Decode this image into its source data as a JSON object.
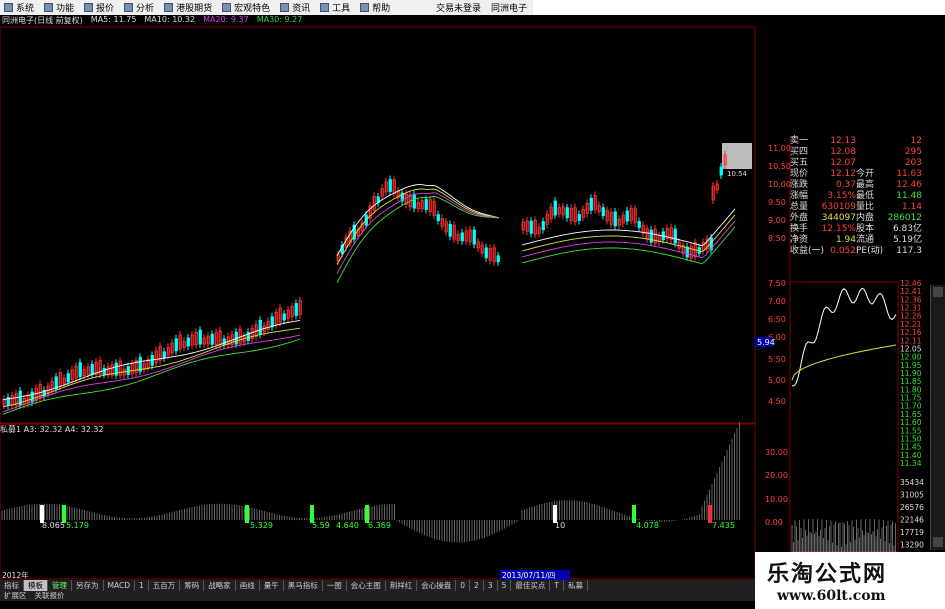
{
  "menubar": {
    "items": [
      "系统",
      "功能",
      "报价",
      "分析",
      "港股期货",
      "宏观特色",
      "资讯",
      "工具",
      "帮助"
    ],
    "right_items": [
      "交易未登录",
      "同洲电子"
    ]
  },
  "infobar": {
    "stock": "同洲电子(日线 前复权)",
    "ma5": "MA5: 11.75",
    "ma10": "MA10: 10.32",
    "ma20": "MA20: 9.37",
    "ma30": "MA30: 9.27"
  },
  "indicator": {
    "title_a": "私募1",
    "title_b": "A3: 32.32",
    "title_c": "A4: 32.32"
  },
  "price_axis": [
    "11.00",
    "10.50",
    "10.00",
    "9.50",
    "9.00",
    "8.50",
    "7.50",
    "7.00",
    "6.50",
    "6.00",
    "5.50",
    "5.00",
    "4.50"
  ],
  "indicator_axis": [
    "30.00",
    "20.00",
    "10.00",
    "0.00"
  ],
  "chart_labels": {
    "current_price": "5.94",
    "high_label": "10.54",
    "ind_values": [
      "8.065",
      "5.179",
      "5.329",
      "5.59",
      "4.640",
      "6.369",
      "10",
      "4.078",
      "7.435"
    ],
    "date_label": "2013/07/11/四"
  },
  "quote": {
    "rows": [
      {
        "l1": "卖一",
        "v1": "12.13",
        "l2": "",
        "v2": "12"
      },
      {
        "l1": "买四",
        "v1": "12.08",
        "l2": "",
        "v2": "295"
      },
      {
        "l1": "买五",
        "v1": "12.07",
        "l2": "",
        "v2": "203"
      },
      {
        "l1": "现价",
        "v1": "12.12",
        "l2": "今开",
        "v2": "11.63"
      },
      {
        "l1": "涨跌",
        "v1": "0.37",
        "l2": "最高",
        "v2": "12.46"
      },
      {
        "l1": "涨幅",
        "v1": "3.15%",
        "l2": "最低",
        "v2": "11.48"
      },
      {
        "l1": "总量",
        "v1": "630109",
        "l2": "量比",
        "v2": "1.14"
      },
      {
        "l1": "外盘",
        "v1": "344097",
        "l2": "内盘",
        "v2": "286012"
      },
      {
        "l1": "换手",
        "v1": "12.15%",
        "l2": "股本",
        "v2": "6.83亿"
      },
      {
        "l1": "净资",
        "v1": "1.94",
        "l2": "流通",
        "v2": "5.19亿"
      },
      {
        "l1": "收益(一)",
        "v1": "0.052",
        "l2": "PE(动)",
        "v2": "117.3"
      }
    ]
  },
  "intraday_axis": [
    "12.46",
    "12.41",
    "12.36",
    "12.31",
    "12.26",
    "12.21",
    "12.16",
    "12.11",
    "12.05",
    "12.00",
    "11.95",
    "11.90",
    "11.85",
    "11.80",
    "11.75",
    "11.70",
    "11.65",
    "11.60",
    "11.55",
    "11.50",
    "11.45",
    "11.40",
    "11.34"
  ],
  "volume_axis": [
    "35434",
    "31005",
    "26576",
    "22146",
    "17719",
    "13290"
  ],
  "bottom_tabs": [
    "指标",
    "模板",
    "管理",
    "另存为",
    "MACD",
    "1",
    "五百万",
    "筹码",
    "战略家",
    "画线",
    "量午",
    "黑马指标",
    "一图",
    "会心主图",
    "荆祥红",
    "会心操盘",
    "0",
    "2",
    "3",
    "5",
    "最佳买点",
    "T",
    "私募"
  ],
  "sidebar_tabs": [
    "扩展区",
    "关联报价"
  ],
  "year_label": "2012年",
  "watermark": {
    "title": "乐淘公式网",
    "url": "www.60lt.com"
  },
  "colors": {
    "up": "#ff3030",
    "down": "#00ffff",
    "ma5": "#ffffff",
    "ma10": "#e0e040",
    "ma20": "#e040e0",
    "ma30": "#40e040",
    "grid": "#800000"
  }
}
